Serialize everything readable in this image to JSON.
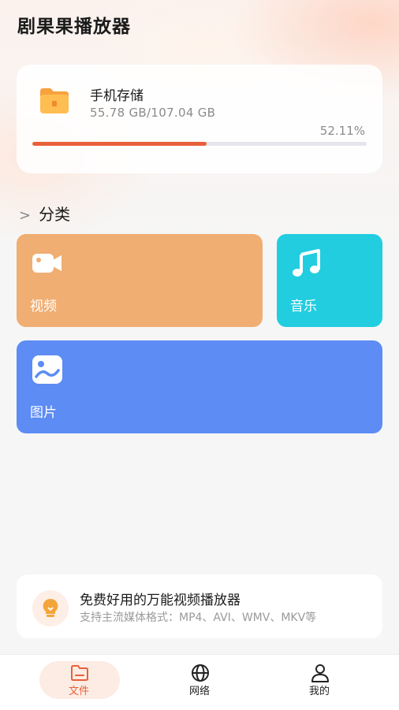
{
  "app": {
    "title": "剧果果播放器"
  },
  "storage": {
    "title": "手机存储",
    "size": "55.78 GB/107.04 GB",
    "percent_text": "52.11%",
    "used_fraction": 0.5211,
    "icon": "folder-icon"
  },
  "categories": {
    "section_chevron": ">",
    "section_title": "分类",
    "items": [
      {
        "label": "视频",
        "icon": "video-camera-icon",
        "color": "#f0ae72"
      },
      {
        "label": "音乐",
        "icon": "music-note-icon",
        "color": "#22cde0"
      },
      {
        "label": "图片",
        "icon": "image-icon",
        "color": "#5c8cf4"
      }
    ]
  },
  "promo": {
    "title": "免费好用的万能视频播放器",
    "subtitle": "支持主流媒体格式：MP4、AVI、WMV、MKV等",
    "icon": "lightbulb-icon"
  },
  "tabbar": {
    "items": [
      {
        "label": "文件",
        "icon": "folder-tab-icon",
        "active": true
      },
      {
        "label": "网络",
        "icon": "globe-icon",
        "active": false
      },
      {
        "label": "我的",
        "icon": "user-icon",
        "active": false
      }
    ]
  },
  "colors": {
    "accent": "#e8603a",
    "progress_track": "#e7e4ec"
  }
}
